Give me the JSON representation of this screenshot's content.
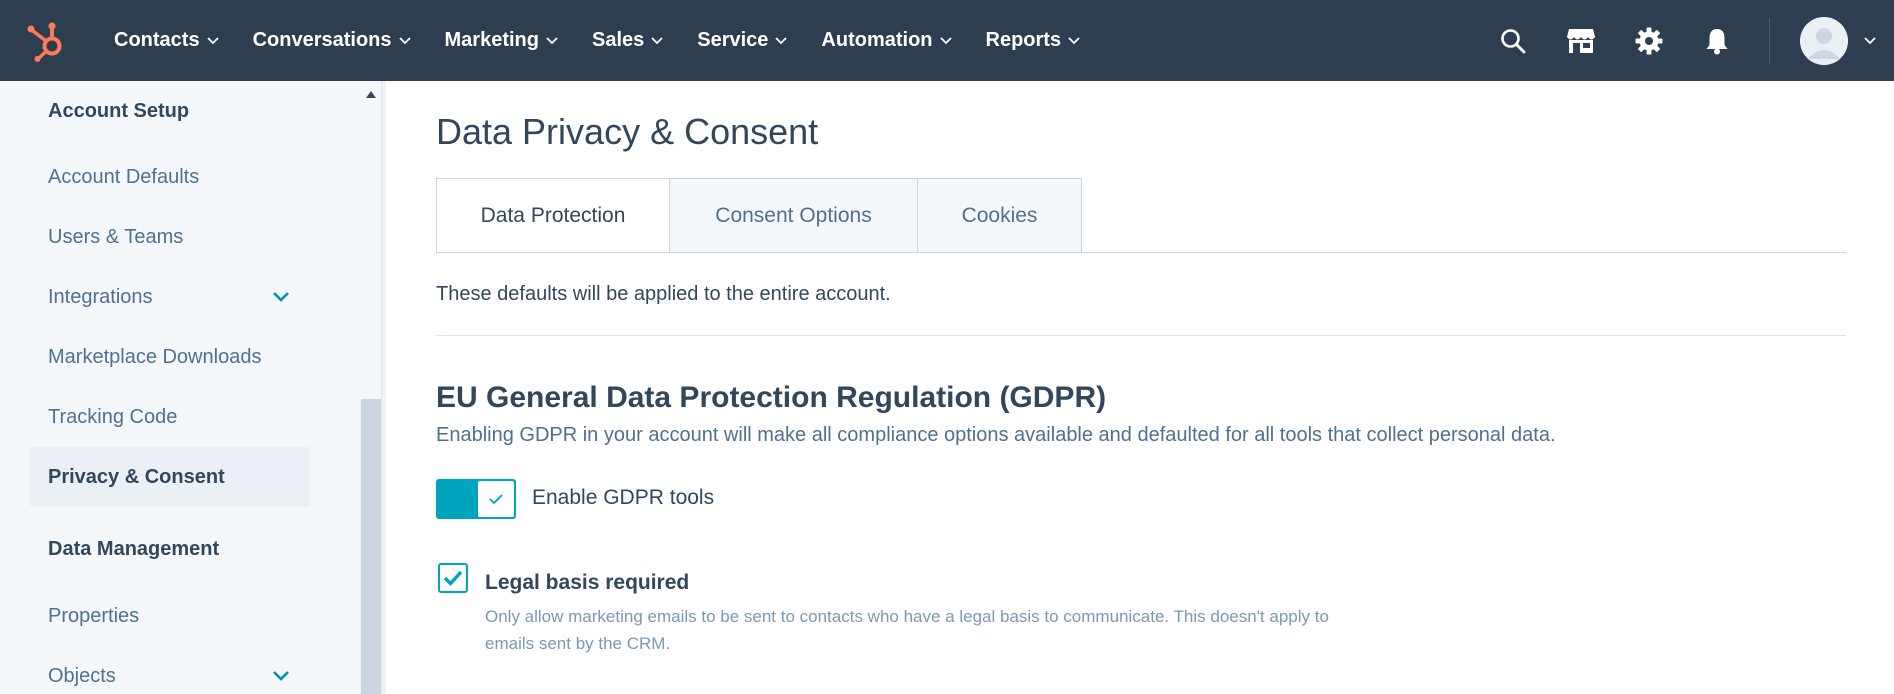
{
  "nav": {
    "items": [
      {
        "label": "Contacts"
      },
      {
        "label": "Conversations"
      },
      {
        "label": "Marketing"
      },
      {
        "label": "Sales"
      },
      {
        "label": "Service"
      },
      {
        "label": "Automation"
      },
      {
        "label": "Reports"
      }
    ],
    "icons": [
      "search-icon",
      "marketplace-icon",
      "settings-gear-icon",
      "notification-bell-icon"
    ]
  },
  "sidebar": {
    "sections": [
      {
        "label": "Account Setup"
      },
      {
        "label": "Data Management"
      }
    ],
    "items": [
      {
        "label": "Account Defaults"
      },
      {
        "label": "Users & Teams"
      },
      {
        "label": "Integrations"
      },
      {
        "label": "Marketplace Downloads"
      },
      {
        "label": "Tracking Code"
      },
      {
        "label": "Privacy & Consent"
      },
      {
        "label": "Properties"
      },
      {
        "label": "Objects"
      }
    ]
  },
  "main": {
    "title": "Data Privacy & Consent",
    "tabs": [
      {
        "label": "Data Protection"
      },
      {
        "label": "Consent Options"
      },
      {
        "label": "Cookies"
      }
    ],
    "intro": "These defaults will be applied to the entire account.",
    "gdpr": {
      "title": "EU General Data Protection Regulation (GDPR)",
      "description": "Enabling GDPR in your account will make all compliance options available and defaulted for all tools that collect personal data.",
      "toggle_label": "Enable GDPR tools",
      "toggle_on": true,
      "checkbox_label": "Legal basis required",
      "checkbox_checked": true,
      "checkbox_help": "Only allow marketing emails to be sent to contacts who have a legal basis to communicate. This doesn't apply to emails sent by the CRM."
    }
  },
  "colors": {
    "nav_bg": "#2d3e50",
    "accent": "#00a4bd",
    "logo": "#ff7a59",
    "text": "#33475b"
  }
}
